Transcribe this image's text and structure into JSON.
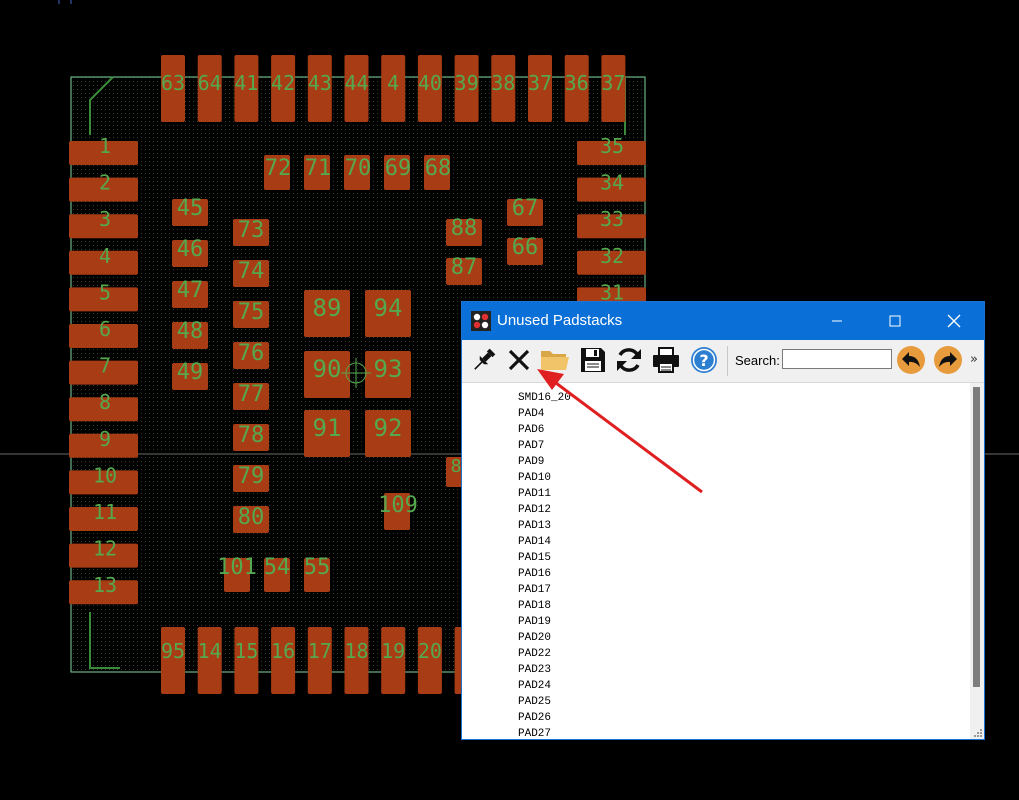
{
  "pcb": {
    "top_labels": [
      "63",
      "64",
      "41",
      "42",
      "43",
      "44",
      "4",
      "40",
      "39",
      "38",
      "37",
      "36",
      "37"
    ],
    "bottom_labels": [
      "95",
      "14",
      "15",
      "16",
      "17",
      "18",
      "19",
      "20",
      "2"
    ],
    "left_labels": [
      "1",
      "2",
      "3",
      "4",
      "5",
      "6",
      "7",
      "8",
      "9",
      "10",
      "11",
      "12",
      "13"
    ],
    "right_labels": [
      "35",
      "34",
      "33",
      "32",
      "31"
    ],
    "row72_labels": [
      "72",
      "71",
      "70",
      "69",
      "68"
    ],
    "col45_labels": [
      "45",
      "46",
      "47",
      "48",
      "49"
    ],
    "col73_labels": [
      "73",
      "74",
      "75",
      "76",
      "77",
      "78",
      "79",
      "80"
    ],
    "center_labels": [
      "89",
      "94",
      "90",
      "93",
      "91",
      "92"
    ],
    "right_col1_labels": [
      "88",
      "87"
    ],
    "right_col2_labels": [
      "67",
      "66"
    ],
    "misc_labels": [
      "8"
    ],
    "label_109": "109",
    "bottom_row_labels": [
      "101",
      "54",
      "55"
    ],
    "colors": {
      "pad": "#a83c14",
      "outline": "#7fd6a0",
      "silk": "#3a8a3a",
      "label": "#56a84e",
      "board_dots": "#2c402c"
    }
  },
  "window": {
    "title": "Unused Padstacks",
    "controls": {
      "minimize_icon": "minimize-icon",
      "maximize_icon": "maximize-icon",
      "close_icon": "close-icon"
    },
    "accent": "#0a6fd6"
  },
  "toolbar": {
    "icons": [
      "pin-icon",
      "delete-x-icon",
      "folder-open-icon",
      "save-icon",
      "refresh-icon",
      "print-icon",
      "help-icon",
      "back-arrow-icon",
      "forward-arrow-icon"
    ],
    "search_label": "Search:",
    "search_value": "",
    "overflow": "»"
  },
  "list": {
    "items": [
      "SMD16_20",
      "PAD4",
      "PAD6",
      "PAD7",
      "PAD9",
      "PAD10",
      "PAD11",
      "PAD12",
      "PAD13",
      "PAD14",
      "PAD15",
      "PAD16",
      "PAD17",
      "PAD18",
      "PAD19",
      "PAD20",
      "PAD22",
      "PAD23",
      "PAD24",
      "PAD25",
      "PAD26",
      "PAD27"
    ]
  }
}
